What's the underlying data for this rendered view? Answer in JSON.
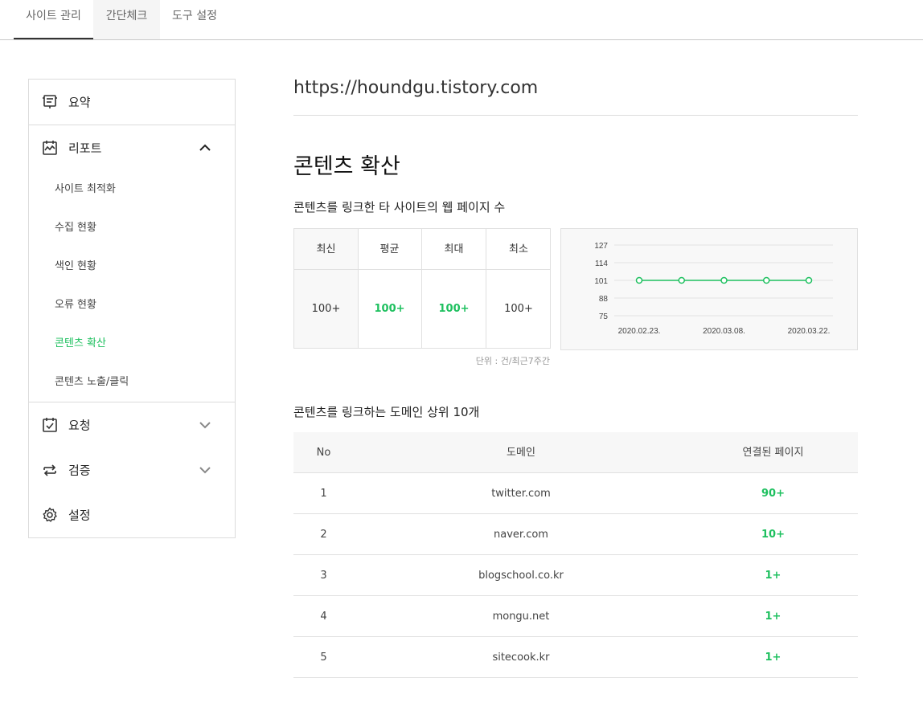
{
  "tabs": [
    "사이트 관리",
    "간단체크",
    "도구 설정"
  ],
  "sidebar": {
    "summary": {
      "label": "요약",
      "icon": "summary-icon"
    },
    "report": {
      "label": "리포트",
      "icon": "report-icon"
    },
    "report_items": [
      "사이트 최적화",
      "수집 현황",
      "색인 현황",
      "오류 현황",
      "콘텐츠 확산",
      "콘텐츠 노출/클릭"
    ],
    "request": {
      "label": "요청",
      "icon": "request-icon"
    },
    "verify": {
      "label": "검증",
      "icon": "verify-icon"
    },
    "settings": {
      "label": "설정",
      "icon": "gear-icon"
    },
    "accent": "#1ec05f"
  },
  "main": {
    "url": "https://houndgu.tistory.com",
    "title": "콘텐츠 확산",
    "section1_title": "콘텐츠를 링크한 타 사이트의 웹 페이지 수",
    "stats": {
      "headers": [
        "최신",
        "평균",
        "최대",
        "최소"
      ],
      "values": [
        "100+",
        "100+",
        "100+",
        "100+"
      ]
    },
    "unit_note": "단위 : 건/최근7주간",
    "section2_title": "콘텐츠를 링크하는 도메인 상위 10개",
    "table": {
      "headers": [
        "No",
        "도메인",
        "연결된 페이지"
      ],
      "rows": [
        {
          "no": "1",
          "domain": "twitter.com",
          "pages": "90+"
        },
        {
          "no": "2",
          "domain": "naver.com",
          "pages": "10+"
        },
        {
          "no": "3",
          "domain": "blogschool.co.kr",
          "pages": "1+"
        },
        {
          "no": "4",
          "domain": "mongu.net",
          "pages": "1+"
        },
        {
          "no": "5",
          "domain": "sitecook.kr",
          "pages": "1+"
        }
      ]
    }
  },
  "chart_data": {
    "type": "line",
    "x": [
      "2020.02.23.",
      "2020.03.01.",
      "2020.03.08.",
      "2020.03.15.",
      "2020.03.22."
    ],
    "x_tick_labels": [
      "2020.02.23.",
      "2020.03.08.",
      "2020.03.22."
    ],
    "series": [
      {
        "values": [
          101,
          101,
          101,
          101,
          101
        ],
        "color": "#1ec05f"
      }
    ],
    "y_ticks": [
      127,
      114,
      101,
      88,
      75
    ],
    "ylim": [
      75,
      127
    ],
    "grid": true
  }
}
